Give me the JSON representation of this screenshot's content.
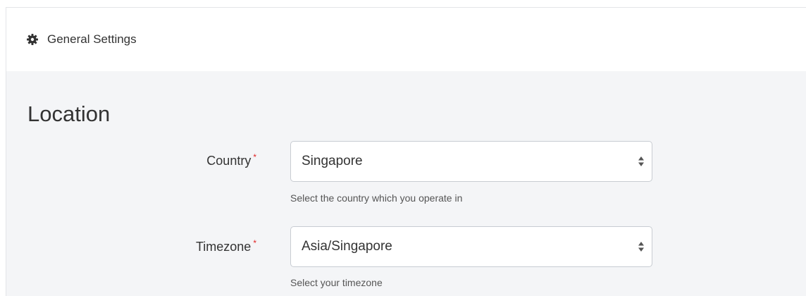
{
  "header": {
    "icon": "gear-icon",
    "title": "General Settings"
  },
  "section": {
    "title": "Location"
  },
  "fields": [
    {
      "label": "Country",
      "required_mark": "*",
      "value": "Singapore",
      "help": "Select the country which you operate in"
    },
    {
      "label": "Timezone",
      "required_mark": "*",
      "value": "Asia/Singapore",
      "help": "Select your timezone"
    }
  ],
  "colors": {
    "required": "#e02424",
    "panel_background": "#f4f5f7",
    "header_background": "#ffffff"
  }
}
